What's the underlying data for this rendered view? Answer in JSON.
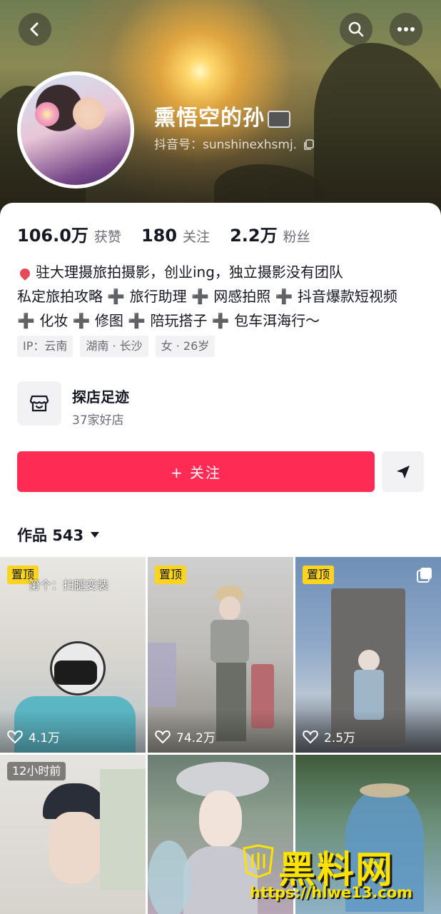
{
  "header": {
    "nickname": "熏悟空的孙",
    "douyin_id": "抖音号：sunshinexhsmj."
  },
  "stats": [
    {
      "value": "106.0万",
      "label": "获赞"
    },
    {
      "value": "180",
      "label": "关注"
    },
    {
      "value": "2.2万",
      "label": "粉丝"
    }
  ],
  "bio": {
    "line1": "驻大理摄旅拍摄影，创业ing，独立摄影没有团队",
    "line2": "私定旅拍攻略 ➕ 旅行助理 ➕ 网感拍照 ➕ 抖音爆款短视频",
    "line3": "➕ 化妆 ➕ 修图 ➕ 陪玩搭子 ➕ 包车洱海行～"
  },
  "tags": [
    "IP：云南",
    "湖南 · 长沙",
    "女 · 26岁"
  ],
  "shop": {
    "title": "探店足迹",
    "subtitle": "37家好店"
  },
  "actions": {
    "follow_label": "+ 关注"
  },
  "works": {
    "label": "作品 543"
  },
  "tiles": [
    {
      "badge": "置顶",
      "likes": "4.1万",
      "caption": "第个：扫腿变装"
    },
    {
      "badge": "置顶",
      "likes": "74.2万"
    },
    {
      "badge": "置顶",
      "likes": "2.5万"
    },
    {
      "time_badge": "12小时前"
    },
    {},
    {}
  ],
  "watermark": {
    "title": "黑料网",
    "url": "https://hlwe13.com"
  },
  "colors": {
    "accent": "#fe2c55",
    "badge": "#fad41f",
    "watermark": "#fbe200"
  }
}
